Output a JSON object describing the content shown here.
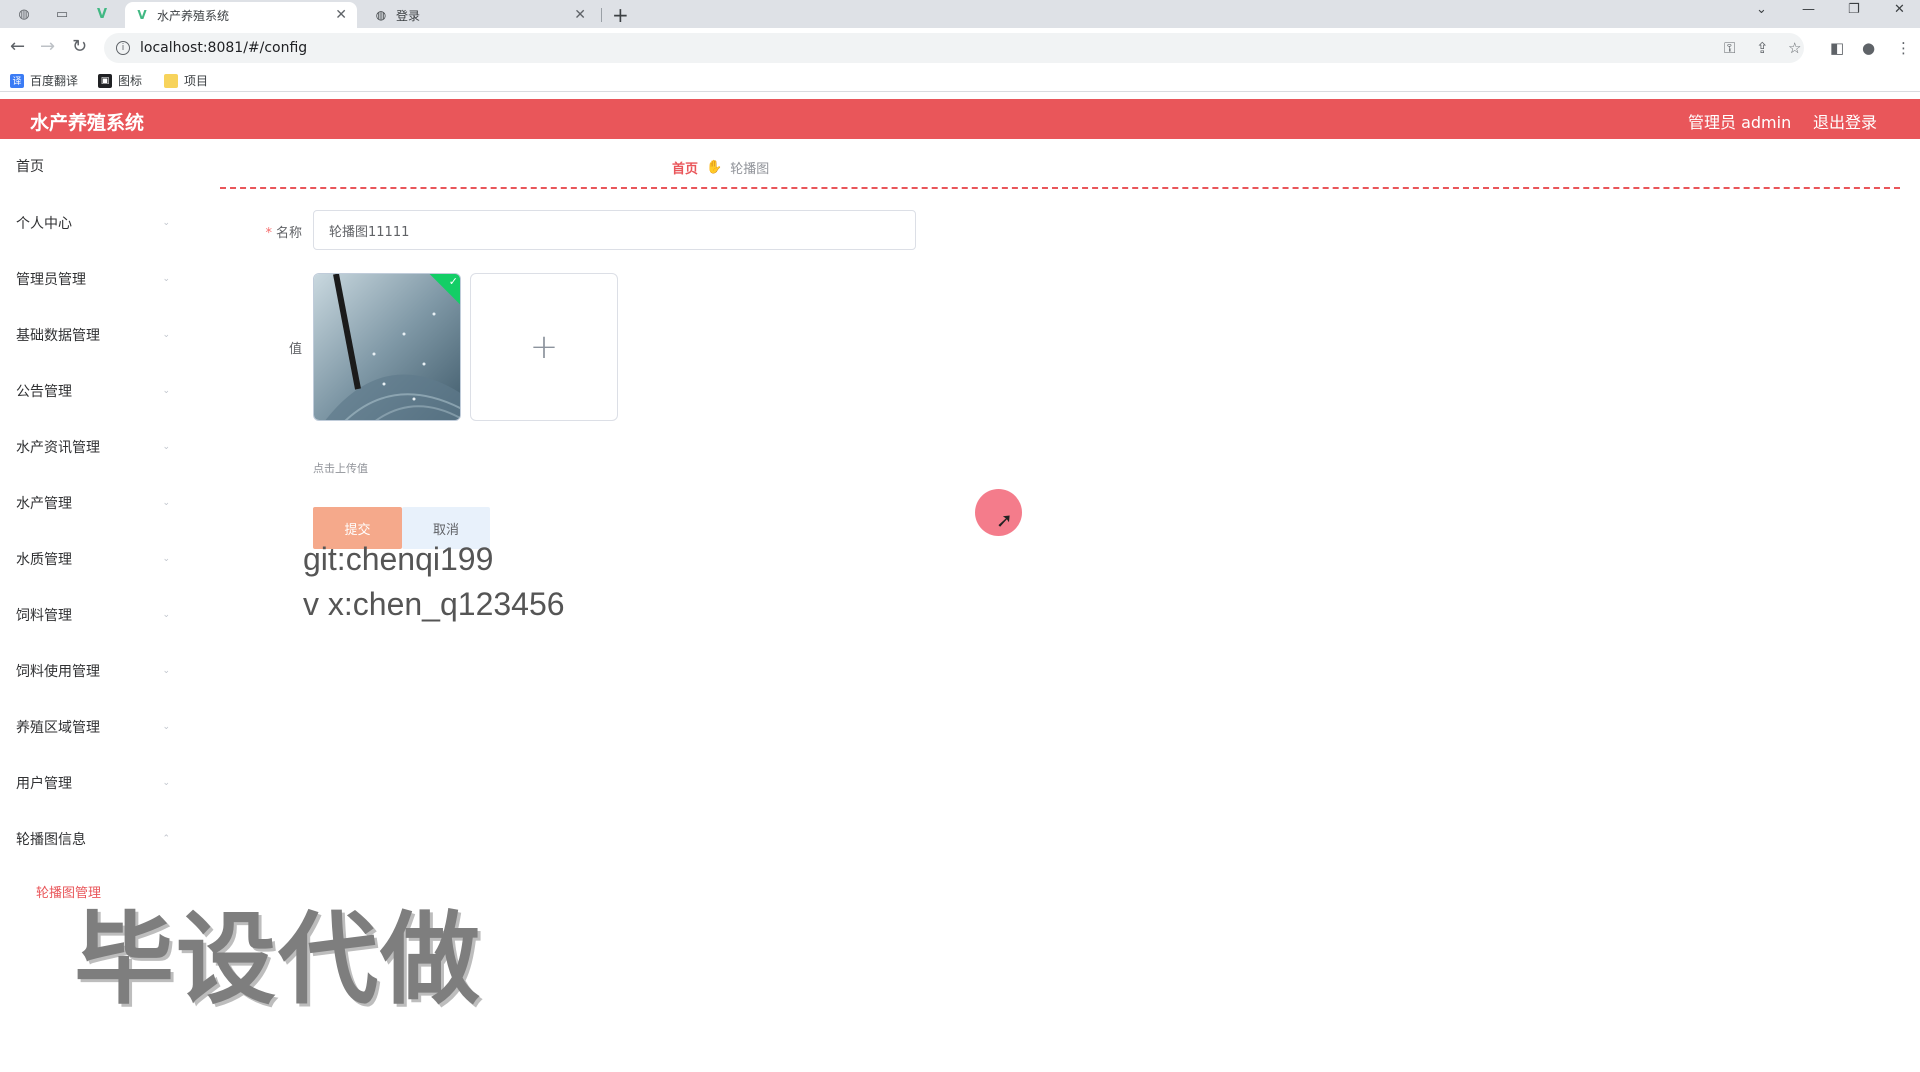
{
  "browser": {
    "tabs": [
      {
        "title": "水产养殖系统",
        "active": true
      },
      {
        "title": "登录",
        "active": false
      }
    ],
    "url": "localhost:8081/#/config",
    "bookmarks": [
      "百度翻译",
      "图标",
      "项目"
    ]
  },
  "app": {
    "title": "水产养殖系统",
    "user": "管理员 admin",
    "logout": "退出登录"
  },
  "sidebar": {
    "items": [
      {
        "label": "首页"
      },
      {
        "label": "个人中心"
      },
      {
        "label": "管理员管理"
      },
      {
        "label": "基础数据管理"
      },
      {
        "label": "公告管理"
      },
      {
        "label": "水产资讯管理"
      },
      {
        "label": "水产管理"
      },
      {
        "label": "水质管理"
      },
      {
        "label": "饲料管理"
      },
      {
        "label": "饲料使用管理"
      },
      {
        "label": "养殖区域管理"
      },
      {
        "label": "用户管理"
      },
      {
        "label": "轮播图信息"
      }
    ],
    "sub_item": "轮播图管理"
  },
  "breadcrumb": {
    "home": "首页",
    "current": "轮播图"
  },
  "form": {
    "name_label": "名称",
    "name_value": "轮播图11111",
    "value_label": "值",
    "upload_hint": "点击上传值",
    "submit": "提交",
    "cancel": "取消"
  },
  "overlay": {
    "line1": "git:chenqi199",
    "line2": "v x:chen_q123456",
    "big": "毕设代做"
  },
  "colors": {
    "accent": "#e9565a",
    "submit_bg": "#f5a98b",
    "cancel_bg": "#e8f1fb"
  }
}
